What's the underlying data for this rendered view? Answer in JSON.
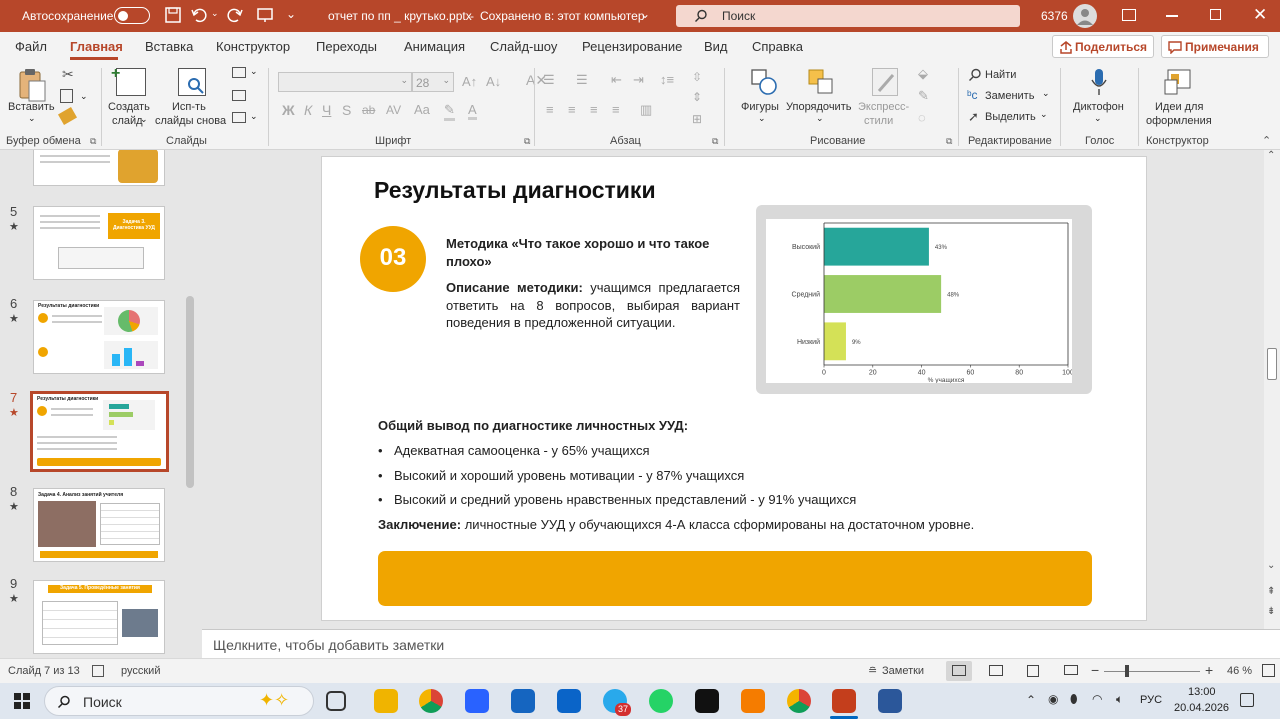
{
  "titlebar": {
    "autosave_label": "Автосохранение",
    "autosave_state": "Откл.",
    "file_title": "отчет по пп _ крутько.pptx",
    "save_status": "Сохранено в: этот компьютер",
    "search_placeholder": "Поиск",
    "user_id": "6376"
  },
  "menu_tabs": [
    "Файл",
    "Главная",
    "Вставка",
    "Конструктор",
    "Переходы",
    "Анимация",
    "Слайд-шоу",
    "Рецензирование",
    "Вид",
    "Справка"
  ],
  "share_button": "Поделиться",
  "comments_button": "Примечания",
  "ribbon": {
    "paste": "Вставить",
    "new_slide": [
      "Создать",
      "слайд"
    ],
    "reuse": [
      "Исп-ть",
      "слайды снова"
    ],
    "font_size": "28",
    "shapes": "Фигуры",
    "arrange": "Упорядочить",
    "quick_styles": [
      "Экспресс-",
      "стили"
    ],
    "find": "Найти",
    "replace": "Заменить",
    "select": "Выделить",
    "dictate": "Диктофон",
    "designer": [
      "Идеи для",
      "оформления"
    ],
    "bold": "Ж",
    "italic": "К",
    "underline": "Ч",
    "strike": "S",
    "groups": [
      "Буфер обмена",
      "Слайды",
      "Шрифт",
      "Абзац",
      "Рисование",
      "Редактирование",
      "Голос",
      "Конструктор"
    ]
  },
  "thumbnails": [
    {
      "num": "5",
      "title": "Задача 3. Диагностика УУД"
    },
    {
      "num": "6",
      "title": "Результаты диагностики"
    },
    {
      "num": "7",
      "title": "Результаты диагностики"
    },
    {
      "num": "8",
      "title": "Задача 4. Анализ занятий учителя"
    },
    {
      "num": "9",
      "title": "Задача 5. Проведённые занятия"
    }
  ],
  "slide": {
    "title": "Результаты диагностики",
    "badge": "03",
    "method_title": "Методика «Что такое хорошо и что такое плохо»",
    "desc_label": "Описание методики:",
    "desc_text": "учащимся предлагается ответить на 8 вопросов, выбирая вариант поведения в предложенной ситуации.",
    "summary_heading": "Общий вывод по диагностике личностных УУД:",
    "bullets": [
      "Адекватная самооценка - у 65% учащихся",
      "Высокий и хороший уровень мотивации - у 87% учащихся",
      "Высокий и средний уровень нравственных представлений - у 91% учащихся"
    ],
    "conclusion_label": "Заключение:",
    "conclusion_text": "личностные УУД у обучающихся 4-А класса сформированы на достаточном уровне."
  },
  "chart_data": {
    "type": "bar",
    "orientation": "horizontal",
    "categories": [
      "Высокий",
      "Средний",
      "Низкий"
    ],
    "values": [
      43,
      48,
      9
    ],
    "data_labels": [
      "43%",
      "48%",
      "9%"
    ],
    "colors": [
      "#26a69a",
      "#9ccc65",
      "#d4e157"
    ],
    "xlabel": "% учащихся",
    "xticks": [
      "0",
      "20",
      "40",
      "60",
      "80",
      "100"
    ],
    "xlim": [
      0,
      100
    ]
  },
  "notes_placeholder": "Щелкните, чтобы добавить заметки",
  "status": {
    "slide_count": "Слайд 7 из 13",
    "language": "русский",
    "notes": "Заметки",
    "zoom": "46 %"
  },
  "taskbar": {
    "search": "Поиск",
    "telegram_badge": "37",
    "lang": "РУС",
    "time": "13:00",
    "date": "20.04.2026"
  },
  "colors": {
    "accent": "#b7472a",
    "brand_orange": "#f0a500"
  }
}
